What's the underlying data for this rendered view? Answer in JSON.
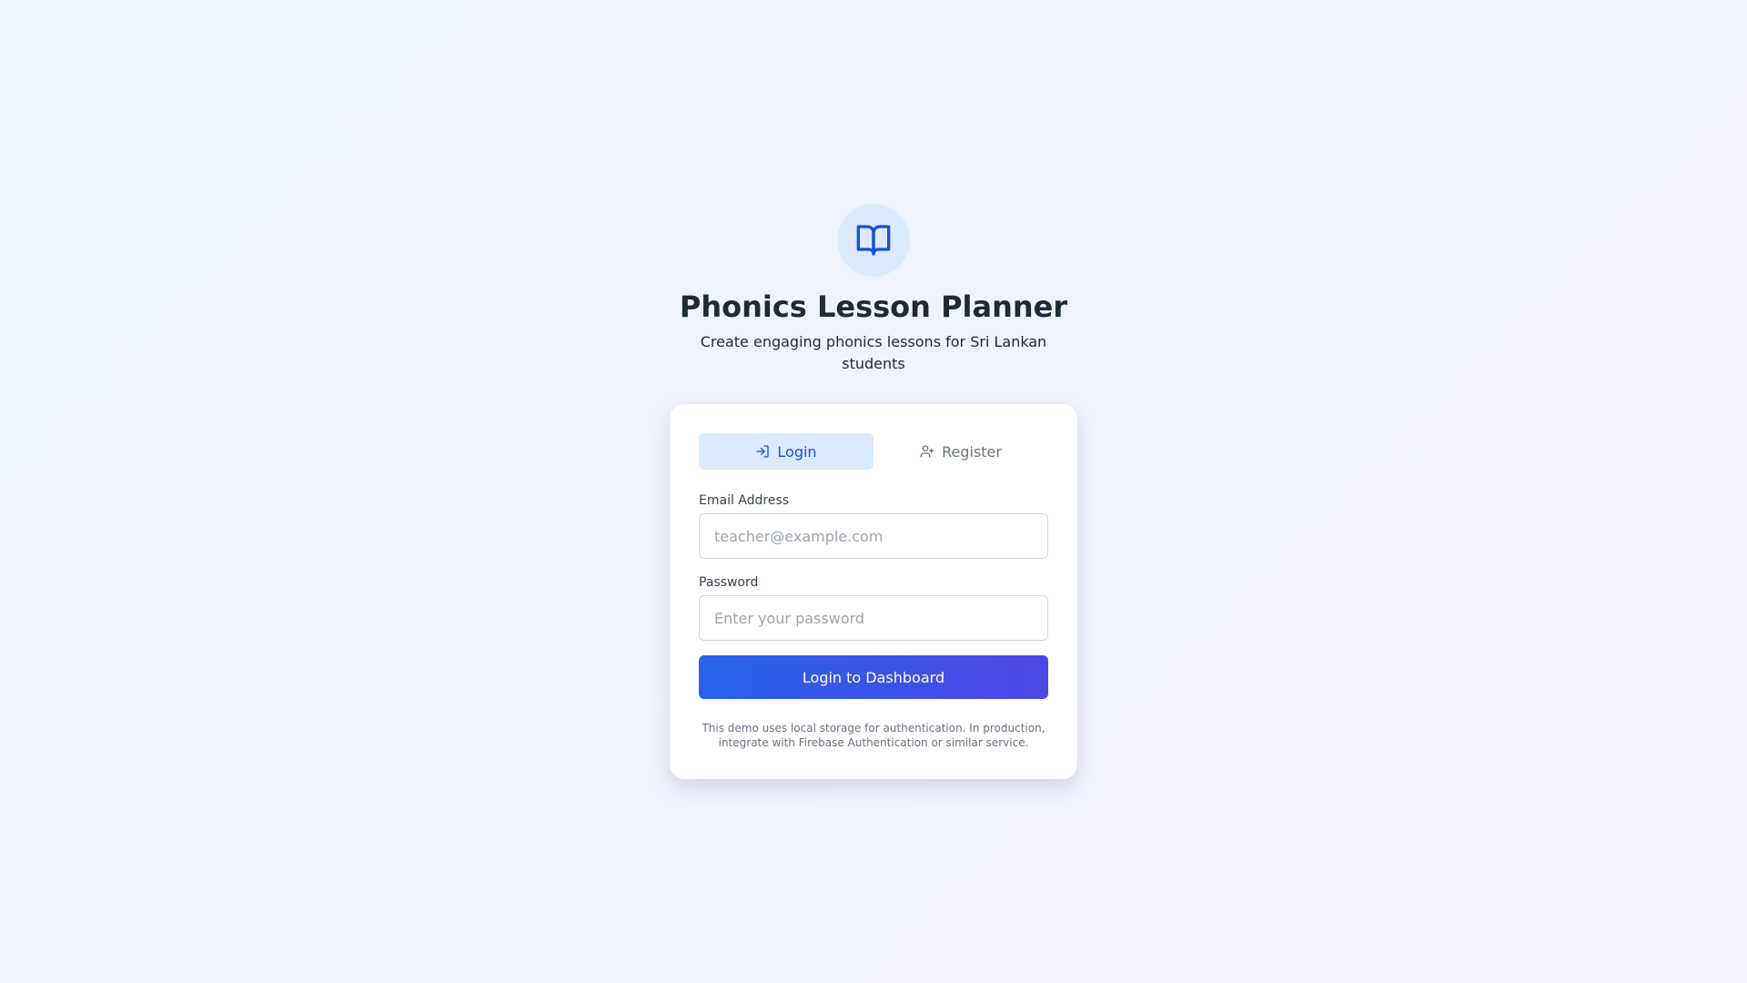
{
  "app": {
    "title": "Phonics Lesson Planner",
    "subtitle": "Create engaging phonics lessons for Sri Lankan students",
    "logo_icon": "book-open-icon"
  },
  "tabs": [
    {
      "label": "Login",
      "icon": "log-in-icon",
      "active": true
    },
    {
      "label": "Register",
      "icon": "user-plus-icon",
      "active": false
    }
  ],
  "form": {
    "email_label": "Email Address",
    "email_placeholder": "teacher@example.com",
    "email_value": "",
    "password_label": "Password",
    "password_placeholder": "Enter your password",
    "password_value": "",
    "submit_label": "Login to Dashboard"
  },
  "footnote": "This demo uses local storage for authentication. In production, integrate with Firebase Authentication or similar service.",
  "colors": {
    "primary": "#2563eb",
    "secondary": "#4f46e5",
    "tab_active_bg": "#dbeafe",
    "logo_bg": "#dbeafe"
  }
}
